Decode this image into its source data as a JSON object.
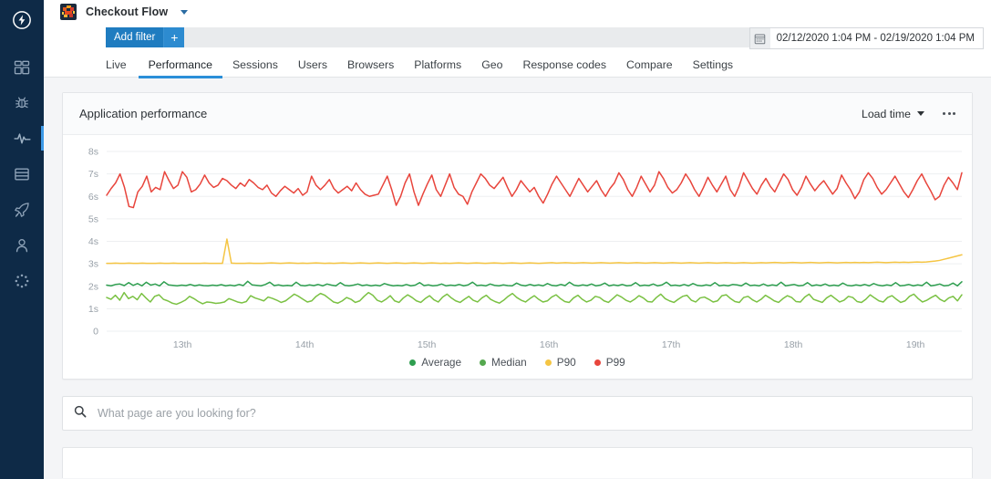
{
  "sidebar": {
    "logo_icon": "bolt-circle-logo",
    "items": [
      {
        "icon": "dashboard-grid-icon",
        "name": "dashboard",
        "active": false
      },
      {
        "icon": "bug-crash-icon",
        "name": "crashes",
        "active": false
      },
      {
        "icon": "activity-pulse-icon",
        "name": "performance",
        "active": true
      },
      {
        "icon": "list-rows-icon",
        "name": "logs",
        "active": false
      },
      {
        "icon": "rocket-icon",
        "name": "releases",
        "active": false
      },
      {
        "icon": "user-icon",
        "name": "users",
        "active": false
      },
      {
        "icon": "loading-dots-icon",
        "name": "more",
        "active": false
      }
    ]
  },
  "appbar": {
    "app_icon": "app-thumbnail-icon",
    "title": "Checkout Flow",
    "caret_icon": "chevron-down-icon"
  },
  "filterbar": {
    "add_filter_label": "Add filter",
    "add_filter_plus": "+",
    "calendar_icon": "calendar-icon",
    "date_range": "02/12/2020 1:04 PM - 02/19/2020 1:04 PM"
  },
  "tabs": [
    {
      "label": "Live",
      "active": false
    },
    {
      "label": "Performance",
      "active": true
    },
    {
      "label": "Sessions",
      "active": false
    },
    {
      "label": "Users",
      "active": false
    },
    {
      "label": "Browsers",
      "active": false
    },
    {
      "label": "Platforms",
      "active": false
    },
    {
      "label": "Geo",
      "active": false
    },
    {
      "label": "Response codes",
      "active": false
    },
    {
      "label": "Compare",
      "active": false
    },
    {
      "label": "Settings",
      "active": false
    }
  ],
  "card": {
    "title": "Application performance",
    "metric_label": "Load time",
    "metric_caret_icon": "chevron-down-icon",
    "kebab_icon": "more-options-icon"
  },
  "search": {
    "icon": "search-icon",
    "placeholder": "What page are you looking for?",
    "value": ""
  },
  "colors": {
    "accent_blue": "#2a8fd8",
    "sidebar_bg": "#0e2a47",
    "average": "#2e9e4f",
    "median": "#7ac143",
    "p90": "#f5c543",
    "p99": "#e8453c"
  },
  "chart_data": {
    "type": "line",
    "title": "Application performance",
    "xlabel": "",
    "ylabel": "Load time",
    "ylim": [
      0,
      8
    ],
    "ytick_labels": [
      "8s",
      "7s",
      "6s",
      "5s",
      "4s",
      "3s",
      "2s",
      "1s",
      "0"
    ],
    "ytick_values": [
      8,
      7,
      6,
      5,
      4,
      3,
      2,
      1,
      0
    ],
    "xtick_labels": [
      "13th",
      "14th",
      "15th",
      "16th",
      "17th",
      "18th",
      "19th"
    ],
    "grid": true,
    "legend_position": "bottom",
    "series": [
      {
        "name": "Average",
        "color": "#2e9e4f",
        "values": [
          2.05,
          2.02,
          2.08,
          2.1,
          2.03,
          2.16,
          2.04,
          2.12,
          2.02,
          2.18,
          2.05,
          2.1,
          2.02,
          2.2,
          2.06,
          2.04,
          2.02,
          2.05,
          2.03,
          2.08,
          2.02,
          2.06,
          2.03,
          2.02,
          2.05,
          2.03,
          2.07,
          2.02,
          2.05,
          2.02,
          2.08,
          2.03,
          2.22,
          2.06,
          2.04,
          2.02,
          2.08,
          2.18,
          2.03,
          2.06,
          2.02,
          2.04,
          2.02,
          2.18,
          2.04,
          2.02,
          2.06,
          2.03,
          2.08,
          2.02,
          2.1,
          2.05,
          2.02,
          2.16,
          2.04,
          2.02,
          2.05,
          2.1,
          2.03,
          2.06,
          2.02,
          2.05,
          2.02,
          2.12,
          2.06,
          2.02,
          2.04,
          2.02,
          2.08,
          2.02,
          2.05,
          2.16,
          2.03,
          2.06,
          2.02,
          2.04,
          2.1,
          2.02,
          2.05,
          2.03,
          2.08,
          2.02,
          2.06,
          2.18,
          2.03,
          2.05,
          2.02,
          2.1,
          2.04,
          2.02,
          2.06,
          2.03,
          2.02,
          2.14,
          2.05,
          2.02,
          2.08,
          2.03,
          2.06,
          2.02,
          2.12,
          2.04,
          2.02,
          2.08,
          2.03,
          2.18,
          2.05,
          2.02,
          2.06,
          2.03,
          2.1,
          2.02,
          2.05,
          2.14,
          2.02,
          2.06,
          2.03,
          2.08,
          2.02,
          2.04,
          2.16,
          2.02,
          2.05,
          2.03,
          2.1,
          2.02,
          2.06,
          2.18,
          2.03,
          2.05,
          2.02,
          2.08,
          2.02,
          2.12,
          2.04,
          2.02,
          2.06,
          2.03,
          2.16,
          2.02,
          2.05,
          2.02,
          2.08,
          2.06,
          2.02,
          2.14,
          2.03,
          2.05,
          2.02,
          2.1,
          2.02,
          2.06,
          2.03,
          2.18,
          2.02,
          2.05,
          2.08,
          2.02,
          2.04,
          2.16,
          2.02,
          2.06,
          2.03,
          2.1,
          2.02,
          2.05,
          2.02,
          2.14,
          2.04,
          2.02,
          2.06,
          2.03,
          2.08,
          2.02,
          2.12,
          2.05,
          2.02,
          2.06,
          2.03,
          2.16,
          2.02,
          2.04,
          2.08,
          2.02,
          2.06,
          2.03,
          2.18,
          2.02,
          2.05,
          2.1,
          2.02,
          2.04,
          2.14,
          2.02,
          2.2
        ]
      },
      {
        "name": "Median",
        "color": "#7ac143",
        "values": [
          1.5,
          1.42,
          1.6,
          1.38,
          1.72,
          1.45,
          1.55,
          1.4,
          1.68,
          1.48,
          1.3,
          1.55,
          1.62,
          1.42,
          1.35,
          1.25,
          1.2,
          1.28,
          1.38,
          1.55,
          1.45,
          1.32,
          1.22,
          1.3,
          1.28,
          1.24,
          1.26,
          1.3,
          1.45,
          1.38,
          1.3,
          1.26,
          1.32,
          1.58,
          1.48,
          1.42,
          1.35,
          1.52,
          1.46,
          1.38,
          1.28,
          1.35,
          1.5,
          1.65,
          1.55,
          1.42,
          1.3,
          1.35,
          1.55,
          1.68,
          1.6,
          1.45,
          1.3,
          1.25,
          1.35,
          1.5,
          1.42,
          1.28,
          1.35,
          1.55,
          1.72,
          1.6,
          1.38,
          1.3,
          1.42,
          1.58,
          1.35,
          1.28,
          1.48,
          1.62,
          1.5,
          1.35,
          1.28,
          1.45,
          1.58,
          1.4,
          1.3,
          1.52,
          1.65,
          1.48,
          1.35,
          1.28,
          1.42,
          1.55,
          1.38,
          1.3,
          1.48,
          1.6,
          1.42,
          1.32,
          1.25,
          1.38,
          1.55,
          1.68,
          1.5,
          1.38,
          1.3,
          1.45,
          1.58,
          1.42,
          1.3,
          1.35,
          1.52,
          1.62,
          1.45,
          1.32,
          1.28,
          1.48,
          1.6,
          1.42,
          1.3,
          1.38,
          1.55,
          1.5,
          1.35,
          1.28,
          1.45,
          1.62,
          1.52,
          1.38,
          1.3,
          1.42,
          1.58,
          1.48,
          1.32,
          1.3,
          1.5,
          1.65,
          1.45,
          1.35,
          1.28,
          1.42,
          1.55,
          1.6,
          1.38,
          1.3,
          1.48,
          1.52,
          1.42,
          1.3,
          1.35,
          1.58,
          1.62,
          1.45,
          1.32,
          1.28,
          1.5,
          1.55,
          1.4,
          1.3,
          1.42,
          1.6,
          1.48,
          1.35,
          1.28,
          1.45,
          1.58,
          1.5,
          1.32,
          1.3,
          1.52,
          1.65,
          1.42,
          1.35,
          1.28,
          1.48,
          1.6,
          1.45,
          1.3,
          1.38,
          1.55,
          1.5,
          1.32,
          1.28,
          1.42,
          1.62,
          1.48,
          1.35,
          1.3,
          1.5,
          1.58,
          1.42,
          1.28,
          1.35,
          1.55,
          1.65,
          1.45,
          1.3,
          1.38,
          1.5,
          1.6,
          1.42,
          1.32,
          1.48,
          1.55,
          1.35,
          1.62
        ]
      },
      {
        "name": "P90",
        "color": "#f5c543",
        "values": [
          3.02,
          3.02,
          3.03,
          3.02,
          3.02,
          3.03,
          3.02,
          3.02,
          3.03,
          3.02,
          3.02,
          3.02,
          3.03,
          3.02,
          3.02,
          3.03,
          3.02,
          3.02,
          3.02,
          3.02,
          3.02,
          3.02,
          3.03,
          3.02,
          3.02,
          3.02,
          3.02,
          4.1,
          3.03,
          3.02,
          3.02,
          3.02,
          3.03,
          3.02,
          3.02,
          3.02,
          3.03,
          3.04,
          3.03,
          3.02,
          3.03,
          3.04,
          3.03,
          3.02,
          3.03,
          3.02,
          3.03,
          3.04,
          3.03,
          3.02,
          3.03,
          3.02,
          3.03,
          3.04,
          3.03,
          3.02,
          3.03,
          3.04,
          3.03,
          3.02,
          3.03,
          3.04,
          3.03,
          3.02,
          3.03,
          3.04,
          3.03,
          3.02,
          3.03,
          3.04,
          3.03,
          3.02,
          3.03,
          3.04,
          3.03,
          3.02,
          3.03,
          3.02,
          3.03,
          3.04,
          3.03,
          3.02,
          3.03,
          3.04,
          3.03,
          3.02,
          3.03,
          3.04,
          3.03,
          3.02,
          3.03,
          3.04,
          3.03,
          3.02,
          3.03,
          3.04,
          3.03,
          3.02,
          3.03,
          3.04,
          3.05,
          3.03,
          3.04,
          3.05,
          3.04,
          3.03,
          3.04,
          3.05,
          3.04,
          3.03,
          3.04,
          3.05,
          3.04,
          3.03,
          3.04,
          3.05,
          3.04,
          3.03,
          3.04,
          3.05,
          3.04,
          3.03,
          3.04,
          3.05,
          3.04,
          3.03,
          3.04,
          3.05,
          3.04,
          3.03,
          3.04,
          3.05,
          3.04,
          3.03,
          3.04,
          3.05,
          3.04,
          3.03,
          3.04,
          3.05,
          3.04,
          3.03,
          3.04,
          3.05,
          3.04,
          3.03,
          3.04,
          3.05,
          3.04,
          3.05,
          3.06,
          3.05,
          3.04,
          3.05,
          3.06,
          3.05,
          3.04,
          3.05,
          3.06,
          3.05,
          3.04,
          3.05,
          3.06,
          3.05,
          3.04,
          3.05,
          3.06,
          3.05,
          3.06,
          3.05,
          3.06,
          3.05,
          3.06,
          3.07,
          3.06,
          3.05,
          3.06,
          3.07,
          3.06,
          3.07,
          3.06,
          3.07,
          3.08,
          3.07,
          3.08,
          3.1,
          3.12,
          3.15,
          3.2,
          3.25,
          3.3,
          3.35,
          3.4
        ]
      },
      {
        "name": "P99",
        "color": "#e8453c",
        "values": [
          6.05,
          6.35,
          6.6,
          7.0,
          6.4,
          5.55,
          5.5,
          6.2,
          6.45,
          6.9,
          6.2,
          6.4,
          6.3,
          7.1,
          6.7,
          6.35,
          6.5,
          7.1,
          6.85,
          6.2,
          6.3,
          6.55,
          6.95,
          6.6,
          6.4,
          6.5,
          6.8,
          6.7,
          6.5,
          6.35,
          6.6,
          6.45,
          6.75,
          6.6,
          6.4,
          6.3,
          6.5,
          6.15,
          6.0,
          6.25,
          6.45,
          6.3,
          6.15,
          6.35,
          6.05,
          6.2,
          6.9,
          6.5,
          6.3,
          6.5,
          6.75,
          6.35,
          6.15,
          6.3,
          6.45,
          6.25,
          6.6,
          6.3,
          6.1,
          6.0,
          6.05,
          6.1,
          6.5,
          6.9,
          6.3,
          5.6,
          6.0,
          6.6,
          7.0,
          6.2,
          5.6,
          6.1,
          6.55,
          6.95,
          6.3,
          6.0,
          6.5,
          7.0,
          6.4,
          6.1,
          6.0,
          5.65,
          6.2,
          6.6,
          7.0,
          6.8,
          6.5,
          6.35,
          6.6,
          6.85,
          6.4,
          6.0,
          6.3,
          6.7,
          6.45,
          6.2,
          6.4,
          6.0,
          5.7,
          6.1,
          6.55,
          6.9,
          6.6,
          6.3,
          6.0,
          6.4,
          6.8,
          6.5,
          6.2,
          6.45,
          6.7,
          6.3,
          6.0,
          6.35,
          6.6,
          7.05,
          6.75,
          6.3,
          6.0,
          6.4,
          6.9,
          6.55,
          6.2,
          6.5,
          7.1,
          6.8,
          6.4,
          6.15,
          6.3,
          6.6,
          7.0,
          6.7,
          6.3,
          6.0,
          6.4,
          6.85,
          6.5,
          6.2,
          6.55,
          6.9,
          6.3,
          6.0,
          6.45,
          7.05,
          6.7,
          6.35,
          6.1,
          6.5,
          6.8,
          6.45,
          6.2,
          6.6,
          7.0,
          6.75,
          6.3,
          6.05,
          6.4,
          6.9,
          6.55,
          6.25,
          6.5,
          6.7,
          6.4,
          6.1,
          6.35,
          6.95,
          6.6,
          6.3,
          5.9,
          6.2,
          6.75,
          7.05,
          6.8,
          6.4,
          6.1,
          6.3,
          6.6,
          6.9,
          6.55,
          6.2,
          5.95,
          6.3,
          6.7,
          7.0,
          6.6,
          6.25,
          5.85,
          6.0,
          6.5,
          6.85,
          6.6,
          6.3,
          7.05
        ]
      }
    ]
  }
}
